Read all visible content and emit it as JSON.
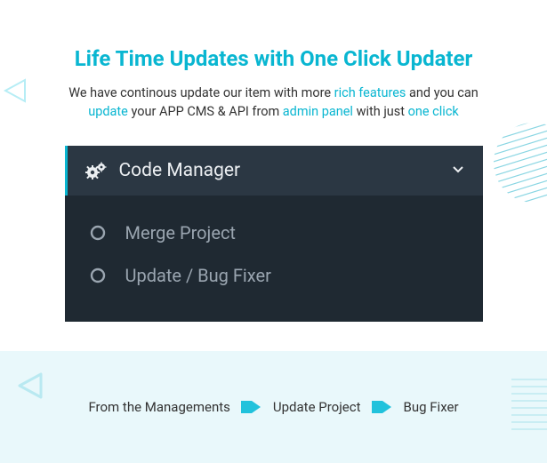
{
  "hero": {
    "title": "Life Time Updates with One Click Updater",
    "line1_a": "We have continous update our item with more ",
    "line1_accent": "rich features",
    "line1_b": " and you can ",
    "line2_accent1": "update",
    "line2_a": " your APP CMS & API from ",
    "line2_accent2": "admin panel",
    "line2_b": " with just ",
    "line2_accent3": "one click"
  },
  "panel": {
    "header_label": "Code Manager",
    "items": [
      {
        "label": "Merge Project"
      },
      {
        "label": "Update / Bug Fixer"
      }
    ]
  },
  "footer": {
    "a": "From the Managements",
    "b": "Update Project",
    "c": "Bug Fixer"
  }
}
